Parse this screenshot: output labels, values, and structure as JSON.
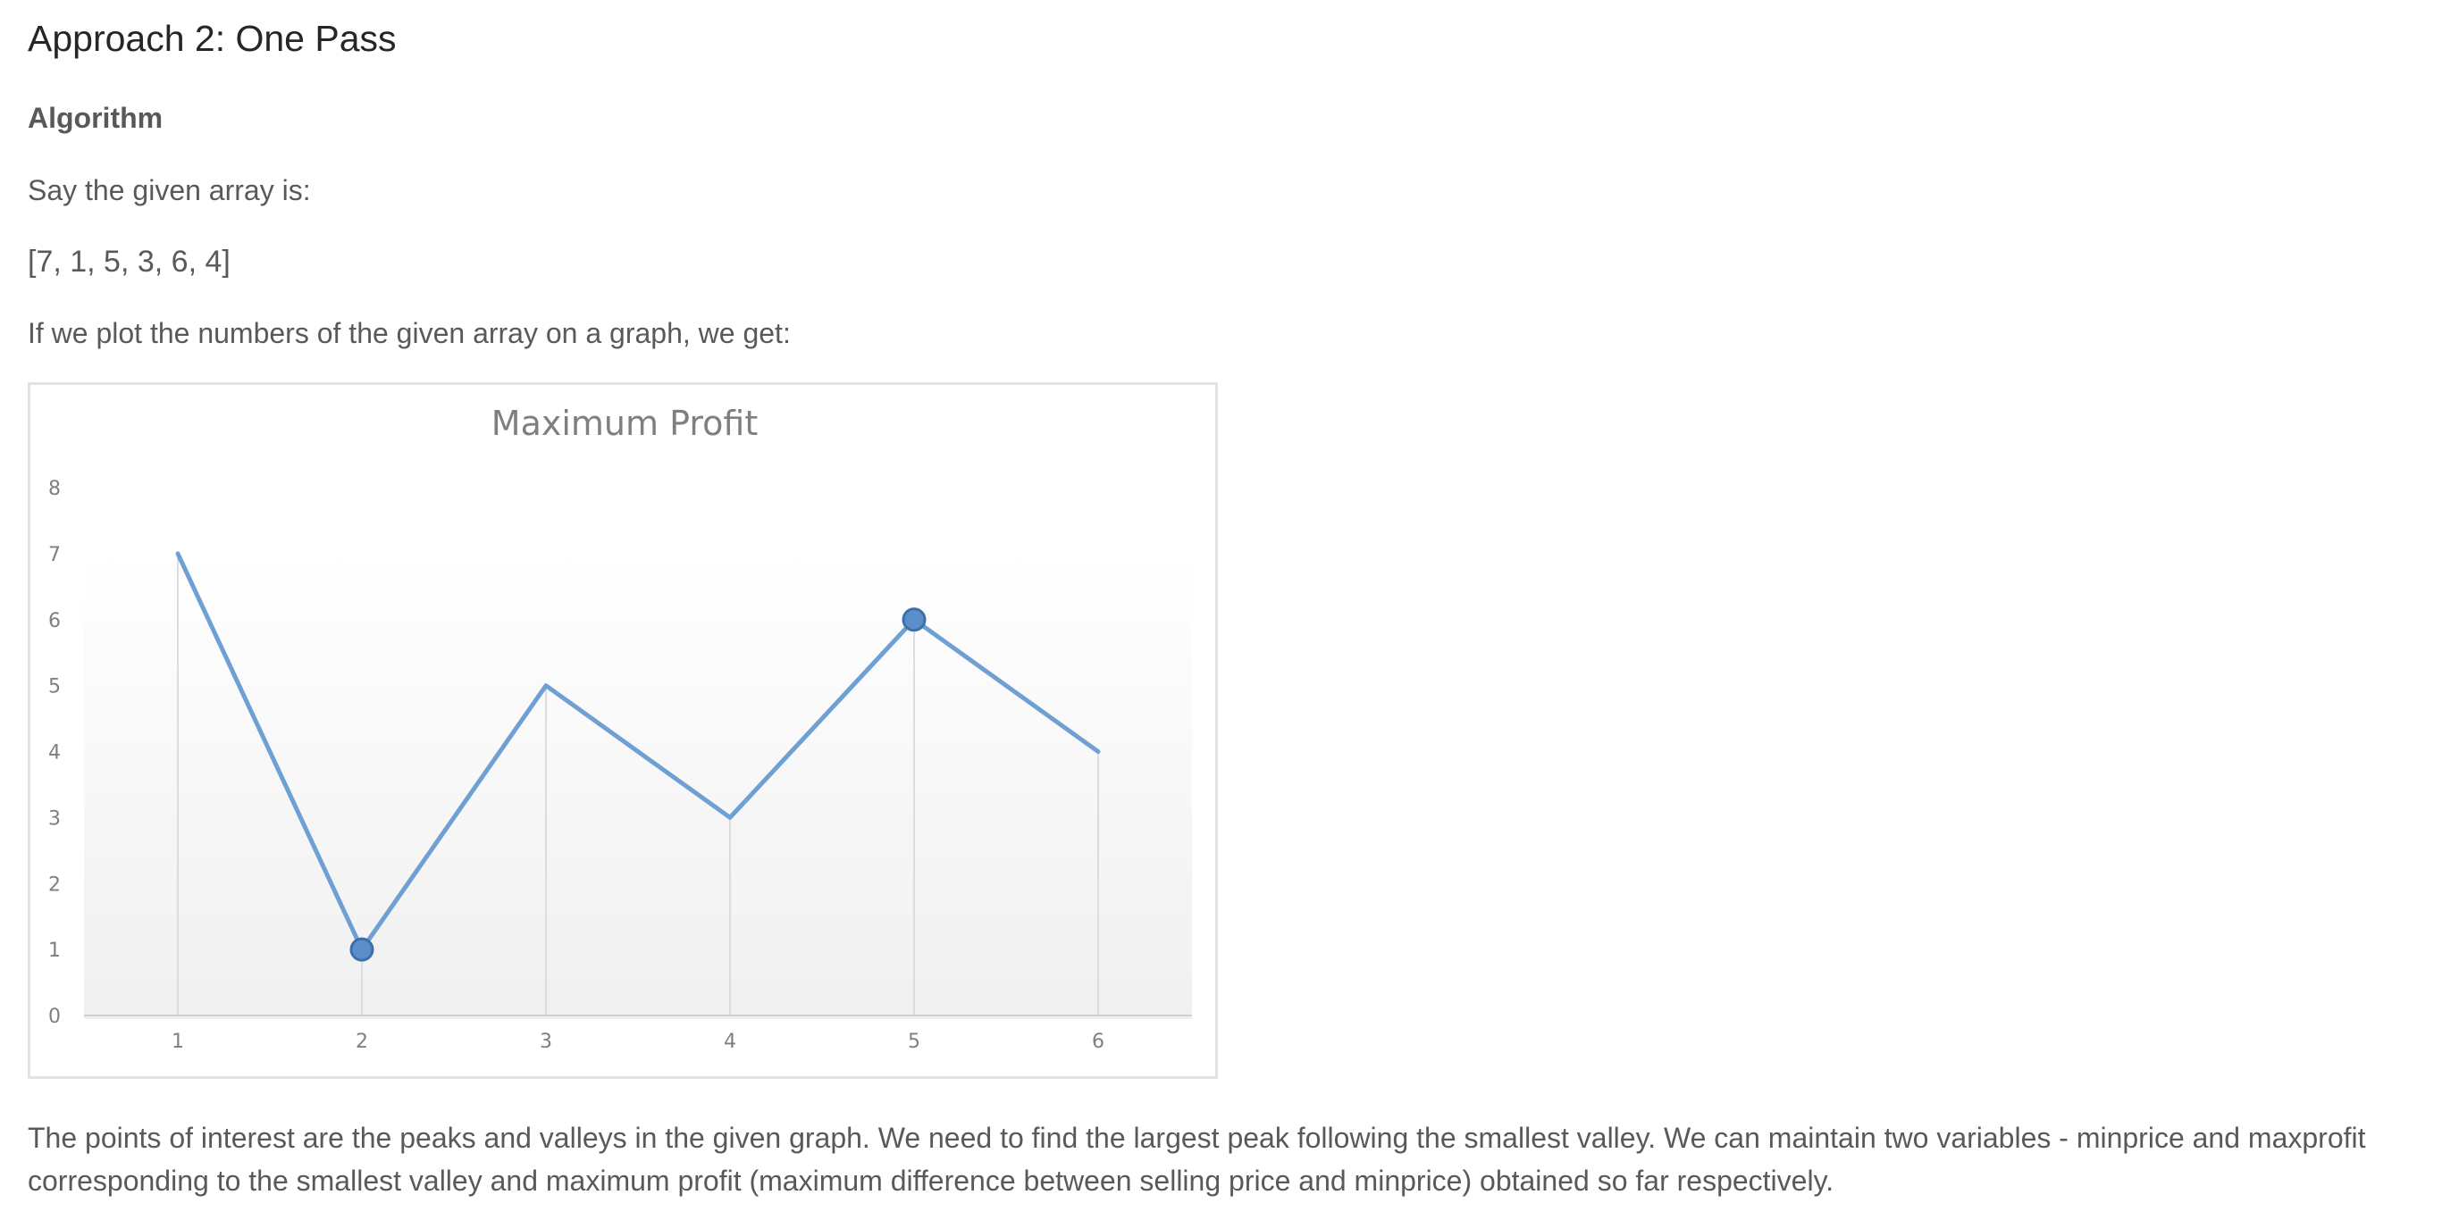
{
  "article": {
    "heading": "Approach 2: One Pass",
    "subheading": "Algorithm",
    "intro": "Say the given array is:",
    "array_text": "[7, 1, 5, 3, 6, 4]",
    "plot_intro": "If we plot the numbers of the given array on a graph, we get:",
    "explanation": "The points of interest are the peaks and valleys in the given graph. We need to find the largest peak following the smallest valley. We can maintain two variables - minprice and maxprofit corresponding to the smallest valley and maximum profit (maximum difference between selling price and minprice) obtained so far respectively."
  },
  "colors": {
    "line": "#6fa0d4",
    "marker_fill": "#5b8fcc",
    "marker_stroke": "#3f6fa8",
    "gridline": "#dcdcdc",
    "axis": "#d0d0d0",
    "plot_bg_top": "#ffffff",
    "plot_bg_bottom": "#f0f0f0"
  },
  "chart_data": {
    "type": "line",
    "title": "Maximum Profit",
    "xlabel": "",
    "ylabel": "",
    "x": [
      1,
      2,
      3,
      4,
      5,
      6
    ],
    "series": [
      {
        "values": [
          7,
          1,
          5,
          3,
          6,
          4
        ]
      }
    ],
    "highlighted_x": [
      2,
      5
    ],
    "ylim": [
      0,
      8
    ],
    "yticks": [
      0,
      1,
      2,
      3,
      4,
      5,
      6,
      7,
      8
    ],
    "xticks": [
      1,
      2,
      3,
      4,
      5,
      6
    ],
    "grid": "vertical drop lines at each point",
    "legend": "none"
  }
}
